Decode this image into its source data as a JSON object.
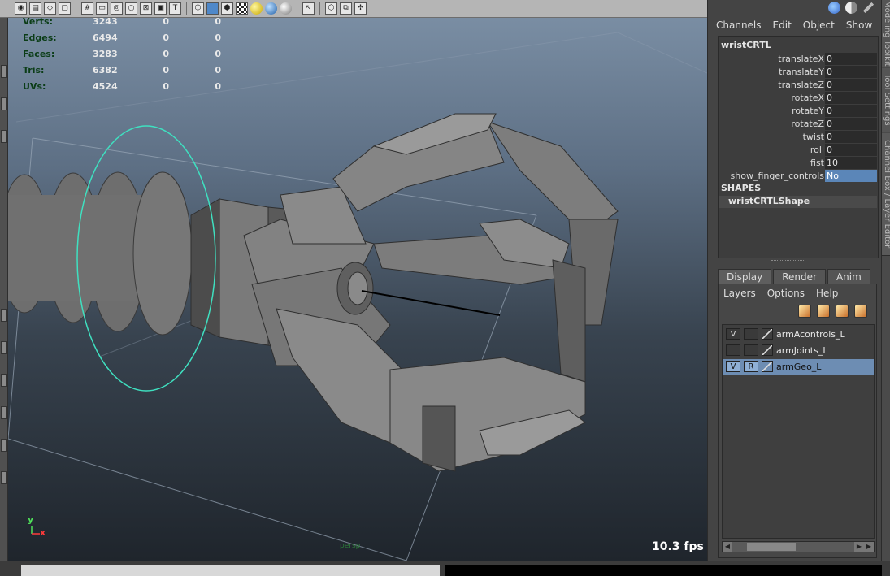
{
  "viewport": {
    "stats": [
      {
        "label": "Verts:",
        "v1": "3243",
        "v2": "0",
        "v3": "0"
      },
      {
        "label": "Edges:",
        "v1": "6494",
        "v2": "0",
        "v3": "0"
      },
      {
        "label": "Faces:",
        "v1": "3283",
        "v2": "0",
        "v3": "0"
      },
      {
        "label": "Tris:",
        "v1": "6382",
        "v2": "0",
        "v3": "0"
      },
      {
        "label": "UVs:",
        "v1": "4524",
        "v2": "0",
        "v3": "0"
      }
    ],
    "fps": "10.3 fps",
    "camera_label": "persp",
    "axis_y": "y",
    "axis_x": "x",
    "toolbar_icons": [
      "camera-icon",
      "camera-attr-icon",
      "bookmark-icon",
      "image-plane-icon",
      "grid-icon",
      "film-gate-icon",
      "resolution-gate-icon",
      "gate-mask-icon",
      "field-chart-icon",
      "safe-action-icon",
      "safe-title-icon",
      "text-icon",
      "wireframe-icon",
      "smooth-shade-icon",
      "wireframe-on-shaded-icon",
      "textured-icon",
      "use-lights-icon",
      "shadows-icon",
      "isolate-icon",
      "select-camera-icon",
      "xray-icon",
      "xray-joints-icon",
      "hardware-icon"
    ]
  },
  "channel_box": {
    "menu": [
      "Channels",
      "Edit",
      "Object",
      "Show"
    ],
    "node_name": "wristCRTL",
    "attributes": [
      {
        "label": "translateX",
        "value": "0"
      },
      {
        "label": "translateY",
        "value": "0"
      },
      {
        "label": "translateZ",
        "value": "0"
      },
      {
        "label": "rotateX",
        "value": "0"
      },
      {
        "label": "rotateY",
        "value": "0"
      },
      {
        "label": "rotateZ",
        "value": "0"
      },
      {
        "label": "twist",
        "value": "0"
      },
      {
        "label": "roll",
        "value": "0"
      },
      {
        "label": "fist",
        "value": "10"
      },
      {
        "label": "show_finger_controls",
        "value": "No"
      }
    ],
    "shapes_header": "SHAPES",
    "shape_name": "wristCRTLShape"
  },
  "layer_editor": {
    "tabs": [
      "Display",
      "Render",
      "Anim"
    ],
    "menu": [
      "Layers",
      "Options",
      "Help"
    ],
    "layers": [
      {
        "v": "V",
        "r": "",
        "name": "armAcontrols_L",
        "selected": false
      },
      {
        "v": "",
        "r": "",
        "name": "armJoints_L",
        "selected": false
      },
      {
        "v": "V",
        "r": "R",
        "name": "armGeo_L",
        "selected": true
      }
    ]
  },
  "side_vertical_tabs": [
    "Modeling Toolkit",
    "Tool Settings",
    "Channel Box / Layer Editor"
  ]
}
